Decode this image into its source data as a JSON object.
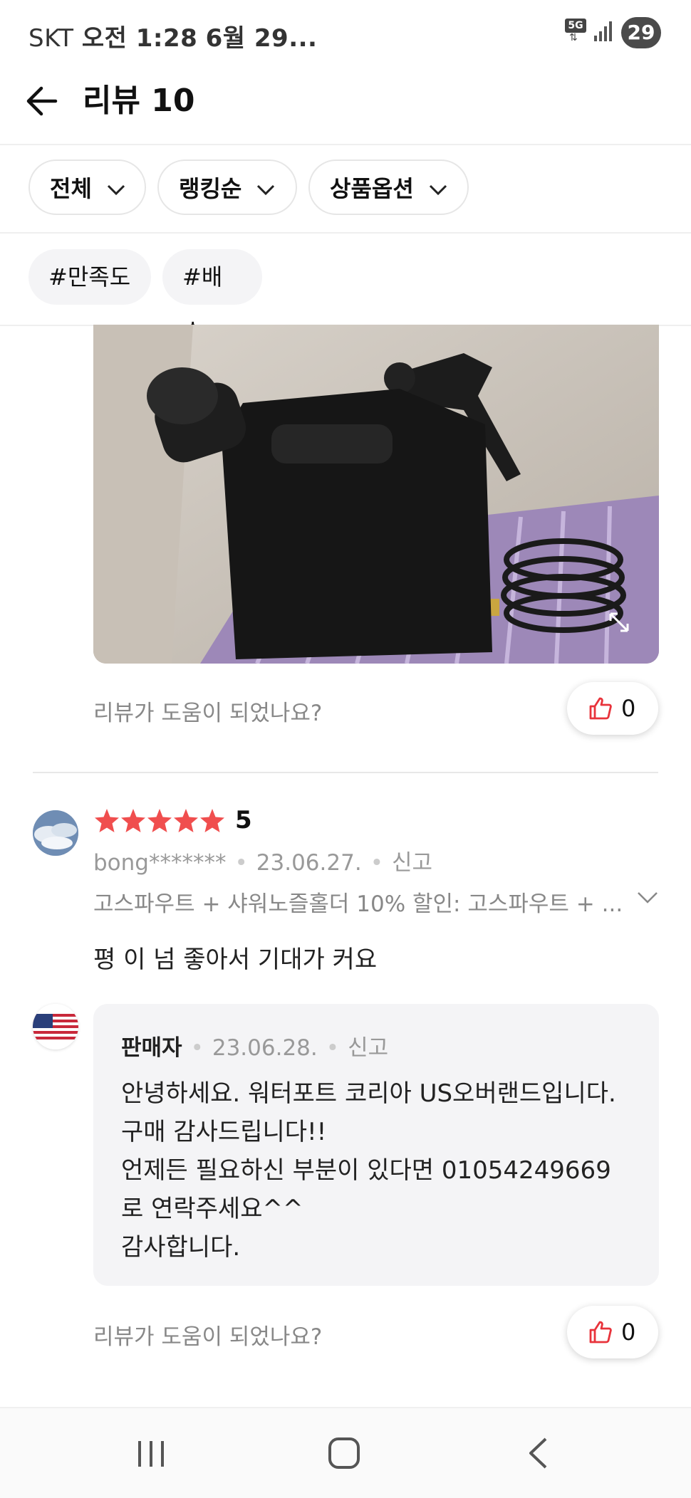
{
  "status_bar": {
    "carrier": "SKT",
    "time": "오전 1:28",
    "date": "6월 29...",
    "network": "5G",
    "battery": "29"
  },
  "header": {
    "title": "리뷰 10"
  },
  "filters": [
    {
      "label": "전체"
    },
    {
      "label": "랭킹순"
    },
    {
      "label": "상품옵션"
    }
  ],
  "hashtags": [
    {
      "label": "#만족도"
    },
    {
      "label": "#배송"
    }
  ],
  "review_1": {
    "helpful_question": "리뷰가 도움이 되었나요?",
    "likes": "0"
  },
  "review_2": {
    "rating": "5",
    "rating_value": 5,
    "user": "bong*******",
    "date": "23.06.27.",
    "report": "신고",
    "option": "고스파우트 + 샤워노즐홀더 10% 할인: 고스파우트 + ...",
    "text": "평 이 넘 좋아서 기대가 커요",
    "seller_reply": {
      "name": "판매자",
      "date": "23.06.28.",
      "report": "신고",
      "lines": [
        "안녕하세요. 워터포트 코리아 US오버랜드입니다.",
        "구매 감사드립니다!!",
        "언제든 필요하신 부분이 있다면 01054249669",
        "로 연락주세요^^",
        "감사합니다."
      ]
    },
    "helpful_question": "리뷰가 도움이 되었나요?",
    "likes": "0"
  },
  "colors": {
    "star": "#f04e4e",
    "like_icon": "#e8333b",
    "muted_text": "#888888"
  }
}
